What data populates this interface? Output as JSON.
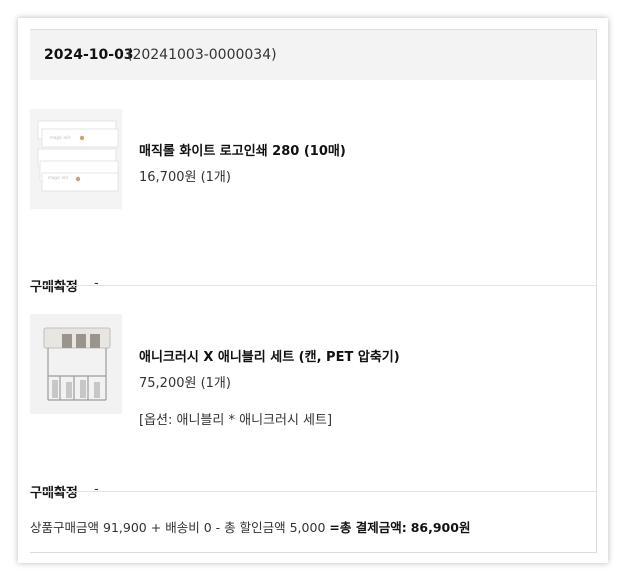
{
  "order": {
    "date": "2024-10-03",
    "number": "(20241003-0000034)"
  },
  "items": [
    {
      "name": "매직롤 화이트 로고인쇄 280 (10매)",
      "price": "16,700원 (1개)",
      "option": "",
      "thumb_icon": "paper-roll-pack-icon",
      "status_label": "구매확정",
      "status_value": "-"
    },
    {
      "name": "애니크러시 X 애니블리 세트 (캔, PET 압축기)",
      "price": "75,200원 (1개)",
      "option": "[옵션: 애니블리 * 애니크러시 세트]",
      "thumb_icon": "compactor-rack-icon",
      "status_label": "구매확정",
      "status_value": "-"
    }
  ],
  "summary": {
    "goods_label": "상품구매금액",
    "goods_amount": "91,900",
    "plus": "+",
    "shipping_label": "배송비",
    "shipping_amount": "0",
    "minus": "-",
    "discount_label": "총 할인금액",
    "discount_amount": "5,000",
    "equals": "=",
    "total_label": "총 결제금액:",
    "total_amount": "86,900원"
  },
  "colors": {
    "header_bg": "#f3f3f3",
    "border": "#dcdcdc",
    "text_dark": "#111111"
  }
}
